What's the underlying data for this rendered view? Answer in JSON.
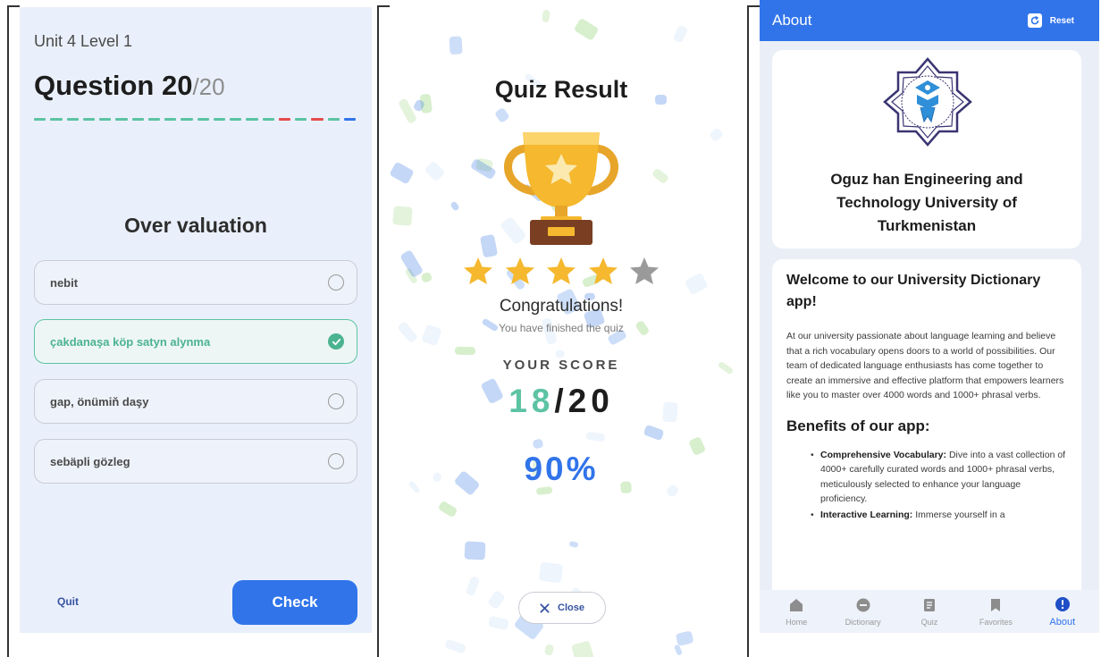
{
  "quiz": {
    "unit_level": "Unit 4 Level 1",
    "question_label": "Question 20",
    "question_total": "/20",
    "progress_segments": [
      "#5cc3a3",
      "#5cc3a3",
      "#5cc3a3",
      "#5cc3a3",
      "#5cc3a3",
      "#5cc3a3",
      "#5cc3a3",
      "#5cc3a3",
      "#5cc3a3",
      "#5cc3a3",
      "#5cc3a3",
      "#5cc3a3",
      "#5cc3a3",
      "#5cc3a3",
      "#5cc3a3",
      "#e34c4c",
      "#5cc3a3",
      "#e34c4c",
      "#5cc3a3",
      "#3174ea"
    ],
    "word": "Over valuation",
    "options": [
      {
        "label": "nebit",
        "selected": false
      },
      {
        "label": "çakdanaşa köp satyn alynma",
        "selected": true
      },
      {
        "label": "gap, önümiň daşy",
        "selected": false
      },
      {
        "label": "sebäpli gözleg",
        "selected": false
      }
    ],
    "quit_label": "Quit",
    "check_label": "Check"
  },
  "result": {
    "title": "Quiz Result",
    "stars_filled": 4,
    "stars_total": 5,
    "congrats": "Congratulations!",
    "finished_text": "You have finished the quiz",
    "your_score_label": "YOUR SCORE",
    "score_got": "18",
    "score_sep": "/",
    "score_total": "20",
    "percent": "90%",
    "close_label": "Close"
  },
  "about": {
    "appbar_title": "About",
    "reset_label": "Reset",
    "university_name": "Oguz han Engineering and Technology University of Turkmenistan",
    "welcome_heading": "Welcome to our University Dictionary app!",
    "intro": "At our university passionate about language learning and believe that a rich vocabulary opens doors to a world of possibilities. Our team of dedicated language enthusiasts has come together to create an immersive and effective platform that empowers learners like you to master over 4000 words and 1000+ phrasal verbs.",
    "benefits_heading": "Benefits of our app:",
    "benefits": [
      {
        "title": "Comprehensive Vocabulary:",
        "text": " Dive into a vast collection of 4000+ carefully curated words and 1000+ phrasal verbs, meticulously selected to enhance your language proficiency."
      },
      {
        "title": "Interactive Learning:",
        "text": " Immerse yourself in a"
      }
    ],
    "nav": [
      {
        "label": "Home",
        "icon": "home-icon",
        "active": false
      },
      {
        "label": "Dictionary",
        "icon": "dictionary-icon",
        "active": false
      },
      {
        "label": "Quiz",
        "icon": "quiz-icon",
        "active": false
      },
      {
        "label": "Favorites",
        "icon": "favorites-icon",
        "active": false
      },
      {
        "label": "About",
        "icon": "info-icon",
        "active": true
      }
    ]
  },
  "colors": {
    "accent_blue": "#3174ea",
    "correct_green": "#5cc3a3",
    "wrong_red": "#e34c4c",
    "star_gold": "#f5b82e",
    "star_empty": "#9a9a9a"
  }
}
